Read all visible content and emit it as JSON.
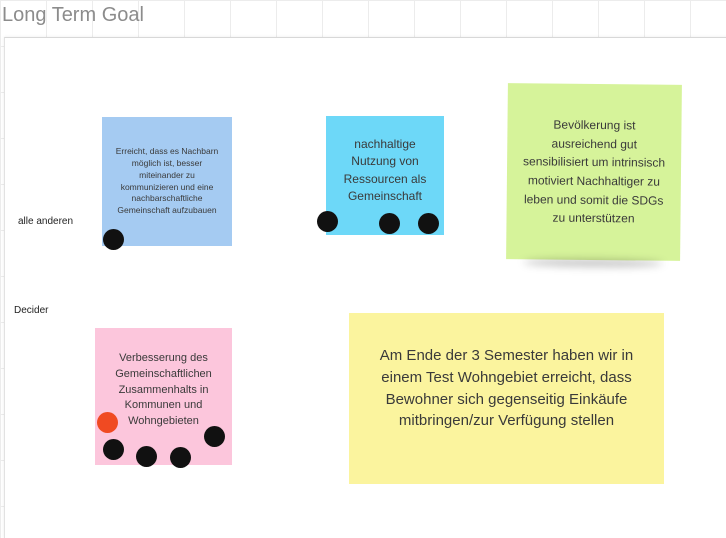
{
  "board": {
    "title": "Long Term Goal"
  },
  "rows": {
    "others_label": "alle anderen",
    "decider_label": "Decider"
  },
  "notes": {
    "blue": {
      "text": "Erreicht, dass es Nachbarn möglich ist, besser miteinander zu kommunizieren und eine nachbarschaftliche Gemeinschaft aufzubauen",
      "color": "#a5cbf2"
    },
    "cyan": {
      "text": "nachhaltige Nutzung von Ressourcen als Gemeinschaft",
      "color": "#6dd8f8"
    },
    "green": {
      "text": "Bevölkerung ist ausreichend gut sensibilisiert um intrinsisch motiviert Nachhaltiger zu leben und somit die SDGs zu unterstützen",
      "color": "#d6f39a"
    },
    "pink": {
      "text": "Verbesserung des Gemeinschaftlichen Zusammenhalts in Kommunen und Wohngebieten",
      "color": "#fcc6dc"
    },
    "yellow": {
      "text": "Am Ende der 3 Semester haben wir in einem Test Wohngebiet erreicht, dass Bewohner sich gegenseitig Einkäufe mitbringen/zur Verfügung stellen",
      "color": "#fbf49e"
    }
  },
  "votes": {
    "dot_color": "#111111",
    "accent_dot_color": "#f04a22"
  }
}
